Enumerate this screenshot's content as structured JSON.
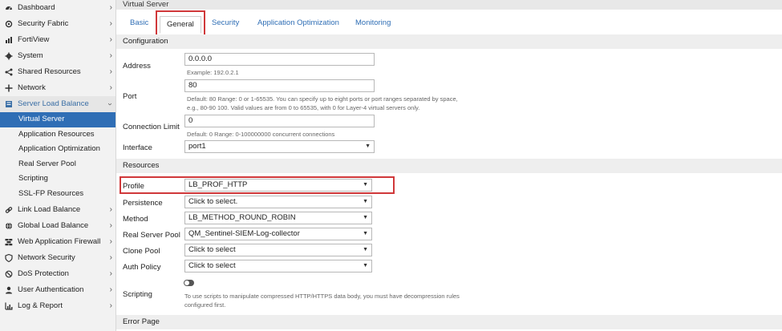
{
  "sidebar": {
    "items": [
      {
        "label": "Dashboard",
        "icon": "dashboard-icon"
      },
      {
        "label": "Security Fabric",
        "icon": "security-fabric-icon"
      },
      {
        "label": "FortiView",
        "icon": "fortiview-icon"
      },
      {
        "label": "System",
        "icon": "gear-icon"
      },
      {
        "label": "Shared Resources",
        "icon": "share-icon"
      },
      {
        "label": "Network",
        "icon": "network-icon"
      },
      {
        "label": "Server Load Balance",
        "icon": "server-icon"
      }
    ],
    "sub_items": [
      {
        "label": "Virtual Server"
      },
      {
        "label": "Application Resources"
      },
      {
        "label": "Application Optimization"
      },
      {
        "label": "Real Server Pool"
      },
      {
        "label": "Scripting"
      },
      {
        "label": "SSL-FP Resources"
      }
    ],
    "items_after": [
      {
        "label": "Link Load Balance",
        "icon": "link-icon"
      },
      {
        "label": "Global Load Balance",
        "icon": "globe-icon"
      },
      {
        "label": "Web Application Firewall",
        "icon": "firewall-icon"
      },
      {
        "label": "Network Security",
        "icon": "shield-icon"
      },
      {
        "label": "DoS Protection",
        "icon": "dos-icon"
      },
      {
        "label": "User Authentication",
        "icon": "user-icon"
      },
      {
        "label": "Log & Report",
        "icon": "chart-icon"
      }
    ]
  },
  "page": {
    "title": "Virtual Server"
  },
  "tabs": [
    "Basic",
    "General",
    "Security",
    "Application Optimization",
    "Monitoring"
  ],
  "configuration": {
    "header": "Configuration",
    "address_label": "Address",
    "address_value": "0.0.0.0",
    "address_hint": "Example: 192.0.2.1",
    "port_label": "Port",
    "port_value": "80",
    "port_hint_1": "Default: 80 Range: 0 or 1-65535. You can specify up to eight ports or port ranges separated by space,",
    "port_hint_2": "e.g., 80-90 100. Valid values are from 0 to 65535, with 0 for Layer-4 virtual servers only.",
    "conn_label": "Connection Limit",
    "conn_value": "0",
    "conn_hint": "Default: 0 Range: 0-100000000 concurrent connections",
    "interface_label": "Interface",
    "interface_value": "port1"
  },
  "resources": {
    "header": "Resources",
    "profile_label": "Profile",
    "profile_value": "LB_PROF_HTTP",
    "persistence_label": "Persistence",
    "persistence_value": "Click to select.",
    "method_label": "Method",
    "method_value": "LB_METHOD_ROUND_ROBIN",
    "pool_label": "Real Server Pool",
    "pool_value": "QM_Sentinel-SIEM-Log-collector",
    "clone_label": "Clone Pool",
    "clone_value": "Click to select",
    "auth_label": "Auth Policy",
    "auth_value": "Click to select",
    "scripting_label": "Scripting",
    "scripting_hint_1": "To use scripts to manipulate compressed HTTP/HTTPS data body, you must have decompression rules",
    "scripting_hint_2": "configured first."
  },
  "error_page": {
    "header": "Error Page"
  },
  "colors": {
    "accent": "#2f6eb5",
    "highlight_box": "#d0383a"
  }
}
